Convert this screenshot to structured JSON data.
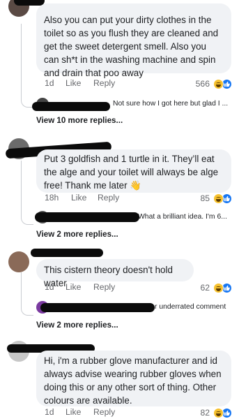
{
  "comments": [
    {
      "text": "Also you can put your dirty clothes in the toilet so as you flush they are cleaned and get the sweet detergent smell. Also you can sh*t in the washing machine  and  spin and drain that poo away",
      "time": "1d",
      "like": "Like",
      "reply": "Reply",
      "reaction_count": "566",
      "reply_preview": "Not sure how I got here but glad I ...",
      "view_more": "View 10 more replies..."
    },
    {
      "text": "Put 3 goldfish and 1 turtle in it. They’ll eat the alge and your toilet will always be alge free! Thank me later 👋",
      "time": "18h",
      "like": "Like",
      "reply": "Reply",
      "reaction_count": "85",
      "reply_preview": "What a brilliant idea. I'm 6...",
      "view_more": "View 2 more replies..."
    },
    {
      "text": "This cistern theory doesn't hold water",
      "time": "1d",
      "like": "Like",
      "reply": "Reply",
      "reaction_count": "62",
      "reply_preview": "r underrated comment",
      "view_more": "View 2 more replies..."
    },
    {
      "text": "Hi, i'm a rubber glove manufacturer and id always advise wearing rubber gloves when doing this or any other sort of thing. Other colours are available.",
      "time": "1d",
      "like": "Like",
      "reply": "Reply",
      "reaction_count": "82"
    }
  ],
  "icons": {
    "haha": "haha-emoji-icon",
    "like": "like-thumb-icon"
  },
  "colors": {
    "bubble": "#f0f2f5",
    "like_blue": "#1877f2",
    "haha_yellow": "#f7c22f",
    "muted": "#65676b"
  }
}
